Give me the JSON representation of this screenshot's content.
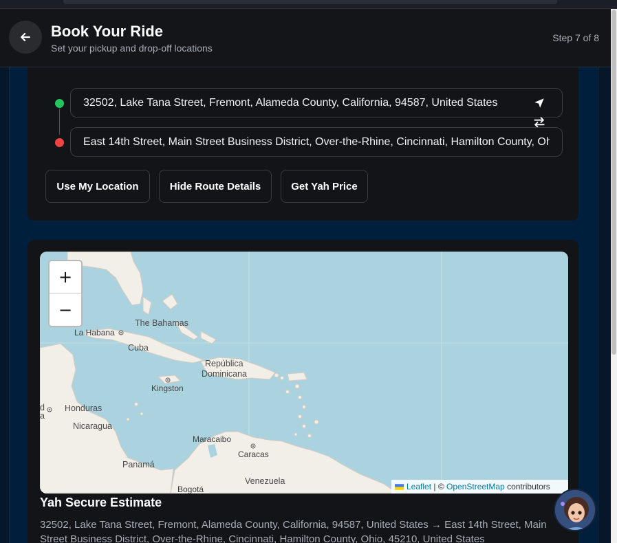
{
  "header": {
    "title": "Book Your Ride",
    "subtitle": "Set your pickup and drop-off locations",
    "step": "Step 7 of 8"
  },
  "locations": {
    "pickup_value": "32502, Lake Tana Street, Fremont, Alameda County, California, 94587, United States",
    "dropoff_value": "East 14th Street, Main Street Business District, Over-the-Rhine, Cincinnati, Hamilton County, Ohio, 45210, United States",
    "pickup_color": "#22c55e",
    "dropoff_color": "#ef4444"
  },
  "actions": {
    "use_location": "Use My Location",
    "hide_route": "Hide Route Details",
    "get_price": "Get Yah Price"
  },
  "map": {
    "zoom_in": "+",
    "zoom_out": "−",
    "labels": {
      "bahamas": "The Bahamas",
      "habana": "La Habana",
      "cuba": "Cuba",
      "republica": "República",
      "dominicana": "Dominicana",
      "kingston": "Kingston",
      "honduras": "Honduras",
      "nicaragua": "Nicaragua",
      "maracaibo": "Maracaibo",
      "caracas": "Caracas",
      "panama": "Panamá",
      "venezuela": "Venezuela",
      "bogota": "Bogotá",
      "edge_d": "d",
      "edge_a": "a"
    },
    "attribution": {
      "leaflet": "Leaflet",
      "separator": "| ©",
      "osm": "OpenStreetMap",
      "contributors": "contributors"
    }
  },
  "estimate": {
    "title": "Yah Secure Estimate",
    "route_text": "32502, Lake Tana Street, Fremont, Alameda County, California, 94587, United States → East 14th Street, Main Street Business District, Over-the-Rhine, Cincinnati, Hamilton County, Ohio, 45210, United States"
  }
}
